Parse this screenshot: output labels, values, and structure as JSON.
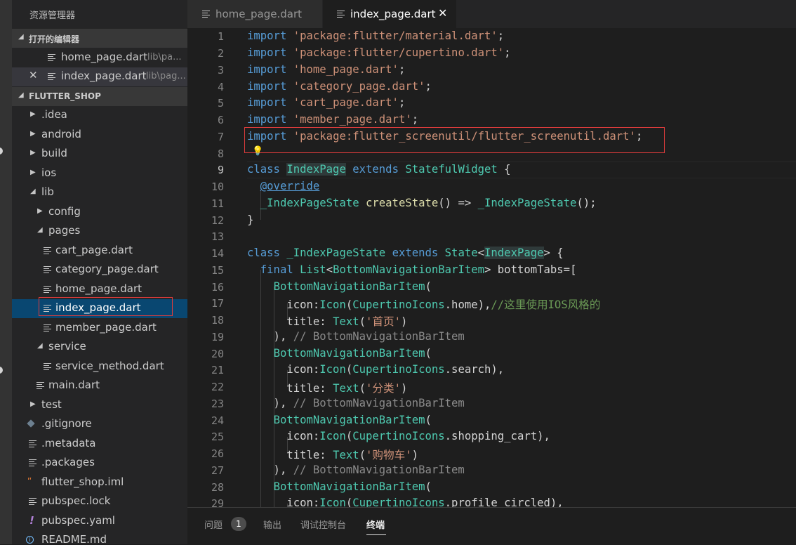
{
  "sidebar": {
    "title": "资源管理器",
    "open_editors": {
      "header": "打开的编辑器",
      "items": [
        {
          "name": "home_page.dart",
          "path": "lib\\pa..."
        },
        {
          "name": "index_page.dart",
          "path": "lib\\pag..."
        }
      ]
    },
    "project": {
      "header": "FLUTTER_SHOP",
      "items": [
        {
          "label": ".idea"
        },
        {
          "label": "android"
        },
        {
          "label": "build"
        },
        {
          "label": "ios"
        },
        {
          "label": "lib"
        },
        {
          "label": "config"
        },
        {
          "label": "pages"
        },
        {
          "label": "cart_page.dart"
        },
        {
          "label": "category_page.dart"
        },
        {
          "label": "home_page.dart"
        },
        {
          "label": "index_page.dart"
        },
        {
          "label": "member_page.dart"
        },
        {
          "label": "service"
        },
        {
          "label": "service_method.dart"
        },
        {
          "label": "main.dart"
        },
        {
          "label": "test"
        },
        {
          "label": ".gitignore"
        },
        {
          "label": ".metadata"
        },
        {
          "label": ".packages"
        },
        {
          "label": "flutter_shop.iml"
        },
        {
          "label": "pubspec.lock"
        },
        {
          "label": "pubspec.yaml"
        },
        {
          "label": "README.md"
        }
      ]
    }
  },
  "tabs": [
    {
      "label": "home_page.dart"
    },
    {
      "label": "index_page.dart"
    }
  ],
  "editor": {
    "line_numbers": [
      "1",
      "2",
      "3",
      "4",
      "5",
      "6",
      "7",
      "8",
      "9",
      "10",
      "11",
      "12",
      "13",
      "14",
      "15",
      "16",
      "17",
      "18",
      "19",
      "20",
      "21",
      "22",
      "23",
      "24",
      "25",
      "26",
      "27",
      "28",
      "29"
    ],
    "lines": {
      "l1": {
        "t1": "import",
        "t2": " ",
        "t3": "'package:flutter/material.dart'",
        "t4": ";"
      },
      "l2": {
        "t1": "import",
        "t2": " ",
        "t3": "'package:flutter/cupertino.dart'",
        "t4": ";"
      },
      "l3": {
        "t1": "import",
        "t2": " ",
        "t3": "'home_page.dart'",
        "t4": ";"
      },
      "l4": {
        "t1": "import",
        "t2": " ",
        "t3": "'category_page.dart'",
        "t4": ";"
      },
      "l5": {
        "t1": "import",
        "t2": " ",
        "t3": "'cart_page.dart'",
        "t4": ";"
      },
      "l6": {
        "t1": "import",
        "t2": " ",
        "t3": "'member_page.dart'",
        "t4": ";"
      },
      "l7": {
        "t1": "import",
        "t2": " ",
        "t3": "'package:flutter_screenutil/flutter_screenutil.dart'",
        "t4": ";"
      },
      "l9": {
        "t1": "class",
        "t2": " ",
        "t3": "IndexPage",
        "t4": " ",
        "t5": "extends",
        "t6": " ",
        "t7": "StatefulWidget",
        "t8": " {"
      },
      "l10": {
        "t1": "  ",
        "t2": "@override"
      },
      "l11": {
        "t1": "  ",
        "t2": "_IndexPageState",
        "t3": " ",
        "t4": "createState",
        "t5": "() => ",
        "t6": "_IndexPageState",
        "t7": "();"
      },
      "l12": {
        "t1": "}"
      },
      "l14": {
        "t1": "class",
        "t2": " ",
        "t3": "_IndexPageState",
        "t4": " ",
        "t5": "extends",
        "t6": " ",
        "t7": "State",
        "t8": "<",
        "t9": "IndexPage",
        "t10": "> {"
      },
      "l15": {
        "t1": "  ",
        "t2": "final",
        "t3": " ",
        "t4": "List",
        "t5": "<",
        "t6": "BottomNavigationBarItem",
        "t7": "> bottomTabs=["
      },
      "l16": {
        "t1": "    ",
        "t2": "BottomNavigationBarItem",
        "t3": "("
      },
      "l17": {
        "t1": "      icon:",
        "t2": "Icon",
        "t3": "(",
        "t4": "CupertinoIcons",
        "t5": ".home),",
        "t6": "//这里使用IOS风格的"
      },
      "l18": {
        "t1": "      title: ",
        "t2": "Text",
        "t3": "(",
        "t4": "'首页'",
        "t5": ")"
      },
      "l19": {
        "t1": "    ), ",
        "t2": "// BottomNavigationBarItem"
      },
      "l20": {
        "t1": "    ",
        "t2": "BottomNavigationBarItem",
        "t3": "("
      },
      "l21": {
        "t1": "      icon:",
        "t2": "Icon",
        "t3": "(",
        "t4": "CupertinoIcons",
        "t5": ".search),"
      },
      "l22": {
        "t1": "      title: ",
        "t2": "Text",
        "t3": "(",
        "t4": "'分类'",
        "t5": ")"
      },
      "l23": {
        "t1": "    ), ",
        "t2": "// BottomNavigationBarItem"
      },
      "l24": {
        "t1": "    ",
        "t2": "BottomNavigationBarItem",
        "t3": "("
      },
      "l25": {
        "t1": "      icon:",
        "t2": "Icon",
        "t3": "(",
        "t4": "CupertinoIcons",
        "t5": ".shopping_cart),"
      },
      "l26": {
        "t1": "      title: ",
        "t2": "Text",
        "t3": "(",
        "t4": "'购物车'",
        "t5": ")"
      },
      "l27": {
        "t1": "    ), ",
        "t2": "// BottomNavigationBarItem"
      },
      "l28": {
        "t1": "    ",
        "t2": "BottomNavigationBarItem",
        "t3": "("
      },
      "l29": {
        "t1": "      icon:",
        "t2": "Icon",
        "t3": "(",
        "t4": "CupertinoIcons",
        "t5": ".profile_circled),"
      }
    }
  },
  "panel": {
    "tabs": [
      {
        "label": "问题",
        "badge": "1"
      },
      {
        "label": "输出"
      },
      {
        "label": "调试控制台"
      },
      {
        "label": "终端"
      }
    ]
  },
  "colors": {
    "accent_selection": "#094771",
    "highlight_box": "#e03c3c",
    "keyword": "#569cd6",
    "string": "#ce9178",
    "type": "#4ec9b0",
    "function": "#dcdcaa",
    "comment": "#6a9955"
  }
}
